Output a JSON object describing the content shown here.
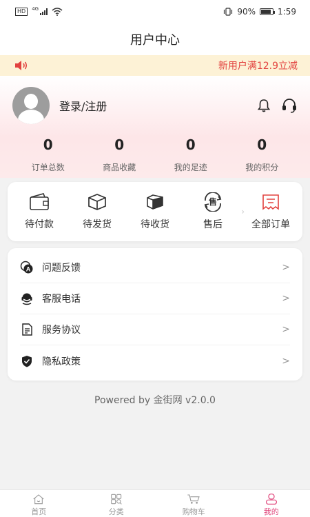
{
  "status_bar": {
    "hd": "HD",
    "network": "4G",
    "battery_percent": "90%",
    "time": "1:59"
  },
  "nav": {
    "title": "用户中心"
  },
  "notice": {
    "icon": "speaker-icon",
    "text": "新用户满12.9立减",
    "accent": "#e2423f"
  },
  "user": {
    "login_label": "登录/注册",
    "avatar_icon": "avatar-placeholder",
    "bell_icon": "bell-icon",
    "support_icon": "headset-icon"
  },
  "stats": [
    {
      "value": "0",
      "label": "订单总数"
    },
    {
      "value": "0",
      "label": "商品收藏"
    },
    {
      "value": "0",
      "label": "我的足迹"
    },
    {
      "value": "0",
      "label": "我的积分"
    }
  ],
  "orders": [
    {
      "label": "待付款",
      "icon": "wallet-icon"
    },
    {
      "label": "待发货",
      "icon": "box-icon"
    },
    {
      "label": "待收货",
      "icon": "delivery-box-icon"
    },
    {
      "label": "售后",
      "icon": "after-sale-icon",
      "icon_text": "售"
    },
    {
      "label": "全部订单",
      "icon": "receipt-icon"
    }
  ],
  "menu": [
    {
      "label": "问题反馈",
      "icon": "feedback-icon"
    },
    {
      "label": "客服电话",
      "icon": "customer-service-icon"
    },
    {
      "label": "服务协议",
      "icon": "document-icon"
    },
    {
      "label": "隐私政策",
      "icon": "shield-check-icon"
    }
  ],
  "powered": "Powered by 金街网 v2.0.0",
  "tabbar": [
    {
      "label": "首页",
      "icon": "home-icon"
    },
    {
      "label": "分类",
      "icon": "category-icon"
    },
    {
      "label": "购物车",
      "icon": "cart-icon"
    },
    {
      "label": "我的",
      "icon": "user-icon"
    }
  ],
  "colors": {
    "brand": "#e0457b",
    "notice_bg": "#fdf2d6",
    "order_accent": "#e2423f"
  }
}
